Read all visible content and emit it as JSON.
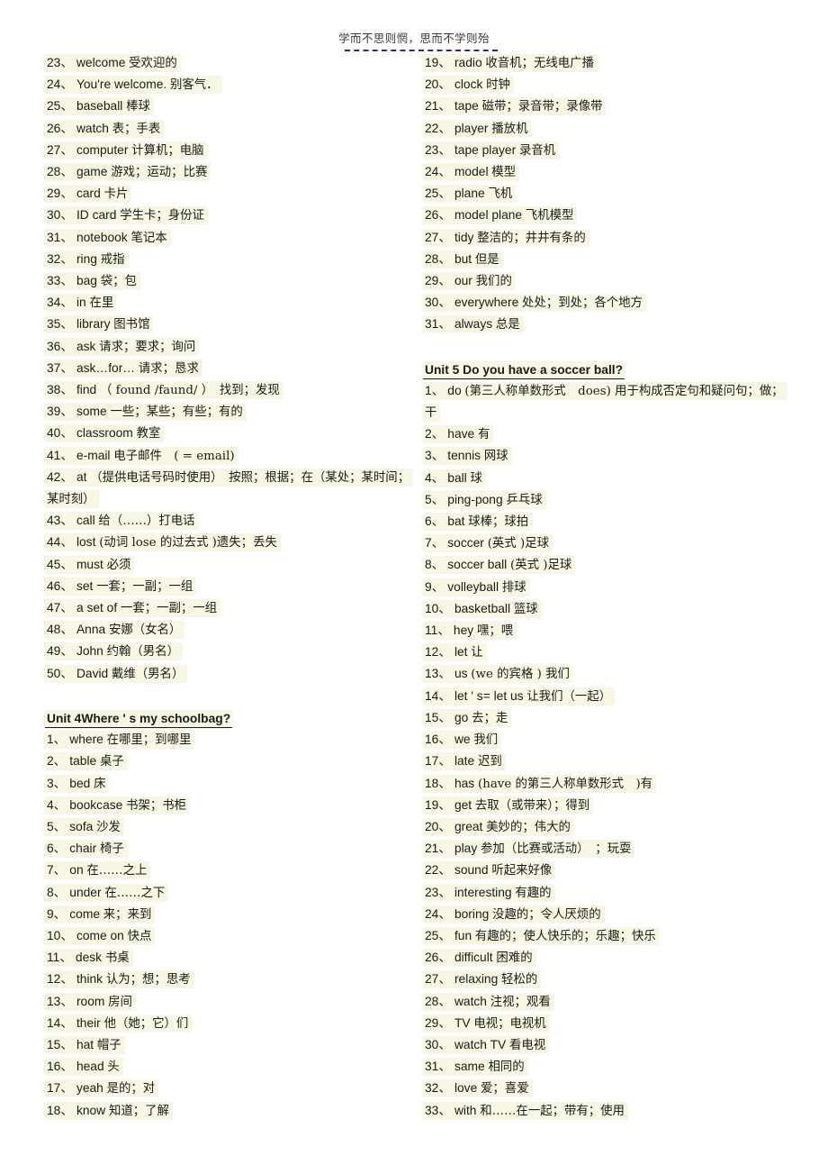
{
  "header": {
    "motto": "学而不思则惘，思而不学则殆",
    "rule": "dashed-divider"
  },
  "left_column": {
    "blocks": [
      {
        "type": "list",
        "items": [
          {
            "num": "23、",
            "en": "welcome",
            "cn": "受欢迎的"
          },
          {
            "num": "24、",
            "en": "You're welcome.",
            "cn": "别客气．"
          },
          {
            "num": "25、",
            "en": "baseball",
            "cn": "棒球"
          },
          {
            "num": "26、",
            "en": "watch",
            "cn": "表；手表"
          },
          {
            "num": "27、",
            "en": "computer",
            "cn": "计算机；电脑"
          },
          {
            "num": "28、",
            "en": "game",
            "cn": "游戏；运动；比赛"
          },
          {
            "num": "29、",
            "en": "card",
            "cn": "卡片"
          },
          {
            "num": "30、",
            "en": "ID card",
            "cn": "学生卡；身份证"
          },
          {
            "num": "31、",
            "en": "notebook",
            "cn": "笔记本"
          },
          {
            "num": "32、",
            "en": "ring",
            "cn": "戒指"
          },
          {
            "num": "33、",
            "en": "bag",
            "cn": "袋；包"
          },
          {
            "num": "34、",
            "en": "in",
            "cn": "在里"
          },
          {
            "num": "35、",
            "en": "library",
            "cn": "图书馆"
          },
          {
            "num": "36、",
            "en": "ask",
            "cn": "请求；要求；询问"
          },
          {
            "num": "37、",
            "en": "ask…for…",
            "cn": "请求；恳求"
          },
          {
            "num": "38、",
            "en": "find",
            "cn": "（ found /faund/ ）　找到；发现"
          },
          {
            "num": "39、",
            "en": "some",
            "cn": "一些；某些；有些；有的"
          },
          {
            "num": "40、",
            "en": "classroom",
            "cn": "教室"
          },
          {
            "num": "41、",
            "en": "e-mail",
            "cn": "电子邮件　( = email)"
          },
          {
            "num": "42、",
            "en": "at",
            "cn": "（提供电话号码时使用）　按照；根据；在（某处；某时间；某时刻）"
          },
          {
            "num": "43、",
            "en": "call",
            "cn": "给（……）打电话"
          },
          {
            "num": "44、",
            "en": "lost",
            "cn": "(动词 lose 的过去式 )遗失；丢失"
          },
          {
            "num": "45、",
            "en": "must",
            "cn": "必须"
          },
          {
            "num": "46、",
            "en": "set",
            "cn": "一套；一副；一组"
          },
          {
            "num": "47、",
            "en": "a set of",
            "cn": "一套；一副；一组"
          },
          {
            "num": "48、",
            "en": "Anna",
            "cn": "安娜（女名）"
          },
          {
            "num": "49、",
            "en": "John",
            "cn": "约翰（男名）"
          },
          {
            "num": "50、",
            "en": "David",
            "cn": "戴维（男名）"
          }
        ]
      },
      {
        "type": "spacer",
        "size": "lg"
      },
      {
        "type": "heading",
        "text": "Unit 4Where  ' s my schoolbag?"
      },
      {
        "type": "list",
        "items": [
          {
            "num": "1、",
            "en": "where",
            "cn": "在哪里；到哪里"
          },
          {
            "num": "2、",
            "en": "table",
            "cn": "桌子"
          },
          {
            "num": "3、",
            "en": "bed",
            "cn": "床"
          },
          {
            "num": "4、",
            "en": "bookcase",
            "cn": "书架；书柜"
          },
          {
            "num": "5、",
            "en": "sofa",
            "cn": "沙发"
          },
          {
            "num": "6、",
            "en": "chair",
            "cn": "椅子"
          },
          {
            "num": "7、",
            "en": "on",
            "cn": "在……之上"
          },
          {
            "num": "8、",
            "en": "under",
            "cn": "在……之下"
          },
          {
            "num": "9、",
            "en": "come",
            "cn": "来；来到"
          },
          {
            "num": "10、",
            "en": "come on",
            "cn": "快点"
          },
          {
            "num": "11、",
            "en": "desk",
            "cn": "书桌"
          },
          {
            "num": "12、",
            "en": "think",
            "cn": "认为；想；思考"
          },
          {
            "num": "13、",
            "en": "room",
            "cn": "房间"
          },
          {
            "num": "14、",
            "en": "their",
            "cn": "他（她；它）们"
          },
          {
            "num": "15、",
            "en": "hat",
            "cn": "帽子"
          },
          {
            "num": "16、",
            "en": "head",
            "cn": "头"
          },
          {
            "num": "17、",
            "en": "yeah",
            "cn": "是的；对"
          },
          {
            "num": "18、",
            "en": "know",
            "cn": "知道；了解"
          }
        ]
      }
    ]
  },
  "right_column": {
    "blocks": [
      {
        "type": "list",
        "items": [
          {
            "num": "19、",
            "en": "radio",
            "cn": "收音机；无线电广播"
          },
          {
            "num": "20、",
            "en": "clock",
            "cn": "时钟"
          },
          {
            "num": "21、",
            "en": "tape",
            "cn": "磁带；录音带；录像带"
          },
          {
            "num": "22、",
            "en": "player",
            "cn": "播放机"
          },
          {
            "num": "23、",
            "en": "tape player",
            "cn": "录音机"
          },
          {
            "num": "24、",
            "en": "model",
            "cn": "模型"
          },
          {
            "num": "25、",
            "en": "plane",
            "cn": "飞机"
          },
          {
            "num": "26、",
            "en": "model plane",
            "cn": "飞机模型"
          },
          {
            "num": "27、",
            "en": "tidy",
            "cn": "整洁的；井井有条的"
          },
          {
            "num": "28、",
            "en": "but",
            "cn": "但是"
          },
          {
            "num": "29、",
            "en": "our",
            "cn": "我们的"
          },
          {
            "num": "30、",
            "en": "everywhere",
            "cn": "处处；到处；各个地方"
          },
          {
            "num": "31、",
            "en": "always",
            "cn": "总是"
          }
        ]
      },
      {
        "type": "spacer",
        "size": "lg"
      },
      {
        "type": "heading",
        "text": "Unit 5 Do you have a soccer ball?"
      },
      {
        "type": "list",
        "items": [
          {
            "num": "1、",
            "en": "do",
            "cn": "(第三人称单数形式　does)  用于构成否定句和疑问句；做；干"
          },
          {
            "num": "2、",
            "en": "have",
            "cn": "有"
          },
          {
            "num": "3、",
            "en": "tennis",
            "cn": "网球"
          },
          {
            "num": "4、",
            "en": "ball",
            "cn": "球"
          },
          {
            "num": "5、",
            "en": "ping-pong",
            "cn": "乒乓球"
          },
          {
            "num": "6、",
            "en": "bat",
            "cn": "球棒；球拍"
          },
          {
            "num": "7、",
            "en": "soccer",
            "cn": "(英式 )足球"
          },
          {
            "num": "8、",
            "en": "soccer ball",
            "cn": "(英式 )足球"
          },
          {
            "num": "9、",
            "en": "volleyball",
            "cn": "排球"
          },
          {
            "num": "10、",
            "en": "basketball",
            "cn": "篮球"
          },
          {
            "num": "11、",
            "en": "hey",
            "cn": "嘿；喂"
          },
          {
            "num": "12、",
            "en": "let",
            "cn": "让"
          },
          {
            "num": "13、",
            "en": "us",
            "cn": "(we 的宾格 ) 我们"
          },
          {
            "num": "14、",
            "en": "let ' s= let us",
            "cn": "让我们（一起）"
          },
          {
            "num": "15、",
            "en": "go",
            "cn": "去；走"
          },
          {
            "num": "16、",
            "en": "we",
            "cn": "我们"
          },
          {
            "num": "17、",
            "en": "late",
            "cn": "迟到"
          },
          {
            "num": "18、",
            "en": "has",
            "cn": "(have 的第三人称单数形式　)有"
          },
          {
            "num": "19、",
            "en": "get",
            "cn": "去取（或带来）；得到"
          },
          {
            "num": "20、",
            "en": "great",
            "cn": "美妙的；伟大的"
          },
          {
            "num": "21、",
            "en": "play",
            "cn": "参加（比赛或活动）　；玩耍"
          },
          {
            "num": "22、",
            "en": "sound",
            "cn": "听起来好像"
          },
          {
            "num": "23、",
            "en": "interesting",
            "cn": "有趣的"
          },
          {
            "num": "24、",
            "en": "boring",
            "cn": "没趣的；令人厌烦的"
          },
          {
            "num": "25、",
            "en": "fun",
            "cn": "有趣的；使人快乐的；乐趣；快乐"
          },
          {
            "num": "26、",
            "en": "difficult",
            "cn": "困难的"
          },
          {
            "num": "27、",
            "en": "relaxing",
            "cn": "轻松的"
          },
          {
            "num": "28、",
            "en": "watch",
            "cn": "注视；观看"
          },
          {
            "num": "29、",
            "en": "TV",
            "cn": "电视；电视机"
          },
          {
            "num": "30、",
            "en": "watch TV",
            "cn": "看电视"
          },
          {
            "num": "31、",
            "en": "same",
            "cn": "相同的"
          },
          {
            "num": "32、",
            "en": "love",
            "cn": "爱；喜爱"
          },
          {
            "num": "33、",
            "en": "with",
            "cn": "和……在一起；带有；使用"
          }
        ]
      }
    ]
  },
  "colors": {
    "highlight": "#f7f7e3",
    "rule": "#2a2a8c",
    "text": "#1a1a1a"
  }
}
